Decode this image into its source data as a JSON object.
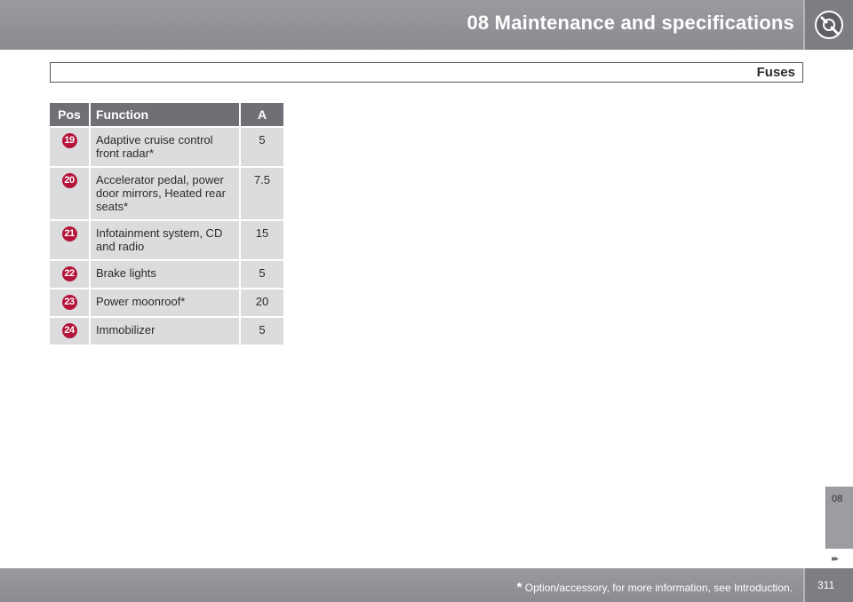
{
  "header": {
    "title": "08 Maintenance and specifications",
    "icon": "wrench-gear-icon"
  },
  "section": {
    "title": "Fuses"
  },
  "table": {
    "columns": [
      "Pos",
      "Function",
      "A"
    ],
    "rows": [
      {
        "pos": "19",
        "function": "Adaptive cruise control front radar*",
        "amps": "5"
      },
      {
        "pos": "20",
        "function": "Accelerator pedal, power door mirrors, Heated rear seats*",
        "amps": "7.5"
      },
      {
        "pos": "21",
        "function": "Infotainment system, CD and radio",
        "amps": "15"
      },
      {
        "pos": "22",
        "function": "Brake lights",
        "amps": "5"
      },
      {
        "pos": "23",
        "function": "Power moonroof*",
        "amps": "20"
      },
      {
        "pos": "24",
        "function": "Immobilizer",
        "amps": "5"
      }
    ]
  },
  "chapter_tab": {
    "number": "08"
  },
  "nav": {
    "arrows": "▸▸"
  },
  "footer": {
    "star": "*",
    "note": "Option/accessory, for more information, see Introduction.",
    "page_number": "311"
  },
  "colors": {
    "header_bg": "#8f9095",
    "table_header_bg": "#6f7075",
    "row_bg": "#dcdcde",
    "pos_badge": "#b5143a"
  }
}
